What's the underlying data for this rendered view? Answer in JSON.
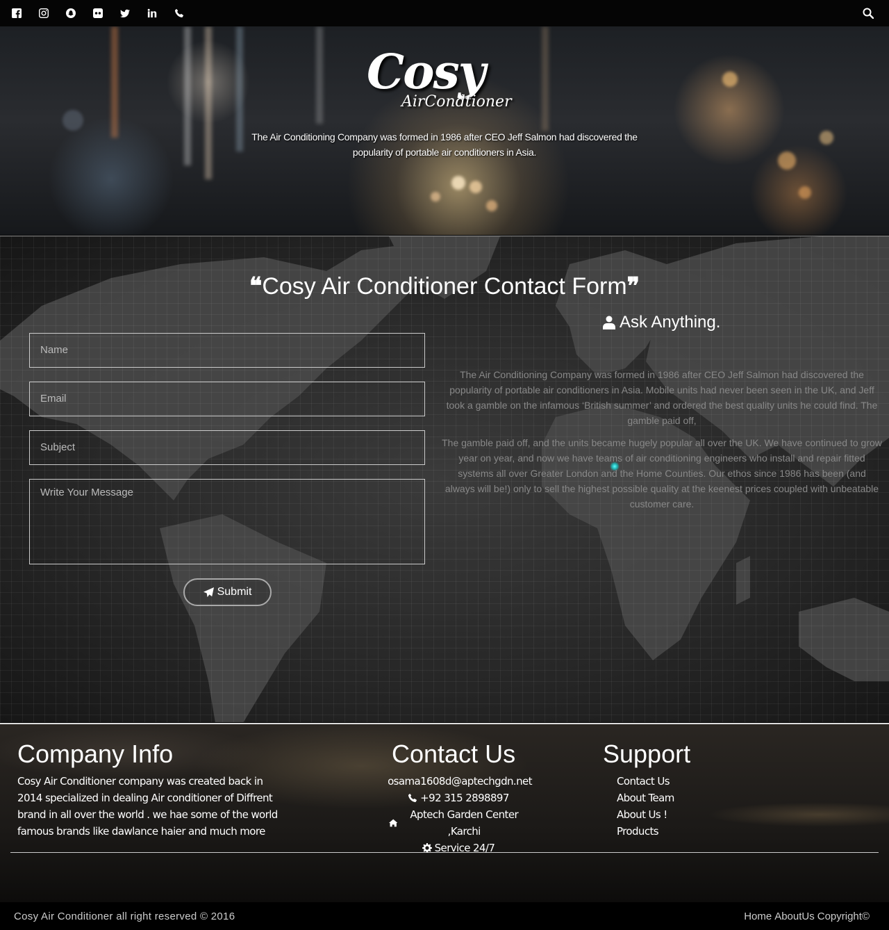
{
  "topbar": {
    "social_icons": [
      "facebook-icon",
      "instagram-icon",
      "snapchat-icon",
      "flickr-icon",
      "twitter-icon",
      "linkedin-icon",
      "phone-icon"
    ],
    "search_icon": "search-icon"
  },
  "hero": {
    "logo_main": "Cosy",
    "logo_sub": "AirCondtioner",
    "tagline": "The Air Conditioning Company was formed in 1986 after CEO Jeff Salmon had discovered the popularity of portable air conditioners in Asia."
  },
  "contact_form": {
    "open_quote": "❝",
    "title": "Cosy Air Conditioner Contact Form",
    "close_quote": "❞",
    "ask_label": "Ask Anything.",
    "fields": {
      "name_placeholder": "Name",
      "email_placeholder": "Email",
      "subject_placeholder": "Subject",
      "message_placeholder": "Write Your Message"
    },
    "submit_label": "Submit",
    "about_p1": "The Air Conditioning Company was formed in 1986 after CEO Jeff Salmon had discovered the popularity of portable air conditioners in Asia. Mobile units had never been seen in the UK, and Jeff took a gamble on the infamous ‘British summer’ and ordered the best quality units he could find. The gamble paid off,",
    "about_p2": "The gamble paid off, and the units became hugely popular all over the UK. We have continued to grow year on year, and now we have teams of air conditioning engineers who install and repair fitted systems all over Greater London and the Home Counties. Our ethos since 1986 has been (and always will be!) only to sell the highest possible quality at the keenest prices coupled with unbeatable customer care."
  },
  "footer": {
    "company_title": "Company Info",
    "company_text": "Cosy Air Conditioner company was created back in 2014 specialized in dealing Air conditioner of Diffrent brand in all over the world . we hae some of the world famous brands like dawlance haier and much more",
    "contact_title": "Contact Us",
    "contact_items": {
      "email": "osama1608d@aptechgdn.net",
      "phone": "+92 315 2898897",
      "address": "Aptech Garden Center ,Karchi",
      "service": "Service 24/7"
    },
    "support_title": "Support",
    "support_items": [
      "Contact Us",
      "About Team",
      "About Us !",
      "Products"
    ]
  },
  "bottom": {
    "copyright": "Cosy Air Conditioner all right reserved © 2016",
    "links": [
      "Home",
      "AboutUs",
      "Copyright©"
    ]
  }
}
